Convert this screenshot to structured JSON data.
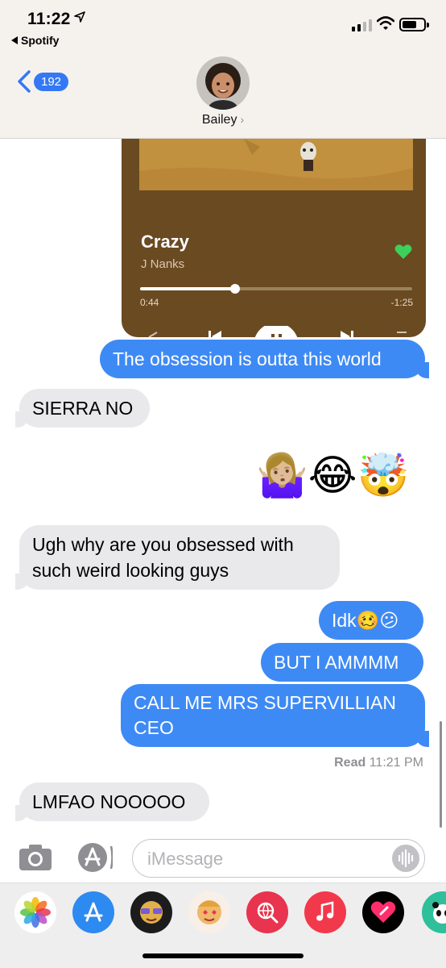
{
  "status_bar": {
    "time": "11:22",
    "back_app": "Spotify"
  },
  "header": {
    "back_count": "192",
    "contact_name": "Bailey",
    "chevron": "›"
  },
  "spotify_card": {
    "song_title": "Crazy",
    "artist": "J Nanks",
    "elapsed": "0:44",
    "remaining": "-1:25",
    "progress": 0.35,
    "accent": "#3ecf5a",
    "background": "#6a4a21"
  },
  "messages": [
    {
      "side": "sent",
      "text": "The obsession is outta this world"
    },
    {
      "side": "received",
      "text": "SIERRA NO"
    },
    {
      "side": "sent",
      "text": "🤷🏼‍♀️😂🤯",
      "type": "emoji"
    },
    {
      "side": "received",
      "text": "Ugh why are you obsessed with such weird looking guys"
    },
    {
      "side": "sent",
      "text": "Idk🥴😕"
    },
    {
      "side": "sent",
      "text": "BUT I AMMMM"
    },
    {
      "side": "sent",
      "text": "CALL ME MRS SUPERVILLIAN CEO"
    },
    {
      "side": "received",
      "text": "LMFAO NOOOOO"
    }
  ],
  "read_receipt": {
    "label": "Read",
    "time": "11:21 PM"
  },
  "input": {
    "placeholder": "iMessage"
  },
  "app_drawer": [
    {
      "name": "photos-icon"
    },
    {
      "name": "app-store-icon"
    },
    {
      "name": "memoji-sticker-icon"
    },
    {
      "name": "memoji-sticker-icon"
    },
    {
      "name": "web-search-icon"
    },
    {
      "name": "music-icon"
    },
    {
      "name": "digital-touch-icon"
    },
    {
      "name": "sticker-app-icon"
    }
  ],
  "colors": {
    "sent_bubble": "#3e8af5",
    "received_bubble": "#e9e9eb",
    "header_bg": "#f5f2ee"
  }
}
